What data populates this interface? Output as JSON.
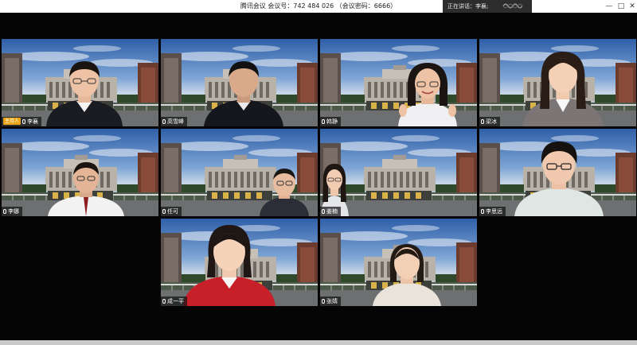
{
  "window": {
    "title": "腾讯会议  会议号：742 484 026  （会议密码：6666）",
    "speaking_label": "正在讲话：李襄;",
    "controls": {
      "minimize": "—",
      "maximize": "□",
      "close": "✕"
    }
  },
  "host_badge": "主持人",
  "participants": [
    {
      "name": "李襄",
      "host": true
    },
    {
      "name": "高雪峰"
    },
    {
      "name": "韩静"
    },
    {
      "name": "梁冰"
    },
    {
      "name": "李娜"
    },
    {
      "name": "任可"
    },
    {
      "name": "姜楠"
    },
    {
      "name": "李思远"
    },
    {
      "name": "成一平"
    },
    {
      "name": "张婧"
    }
  ]
}
